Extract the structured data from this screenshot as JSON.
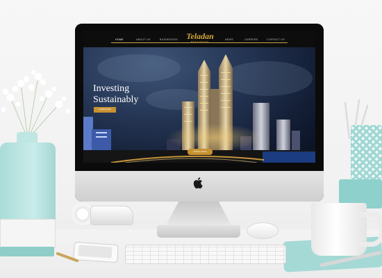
{
  "nav": {
    "items": [
      "HOME",
      "ABOUT US",
      "BUSINESSES",
      "NEWS",
      "CAREERS",
      "CONTACT US"
    ],
    "active_index": 0
  },
  "logo": {
    "name": "Teladan",
    "sub": "RESOURCES"
  },
  "hero": {
    "headline_line1": "Investing",
    "headline_line2": "Sustainably",
    "cta_label": "LEARN MORE",
    "scroll_label": "SCROLL DOWN"
  },
  "colors": {
    "accent_gold": "#c89232",
    "nav_background": "#0d0d0d",
    "desk_teal": "#9ed6d2"
  },
  "icons": [
    "apple-logo-icon"
  ]
}
